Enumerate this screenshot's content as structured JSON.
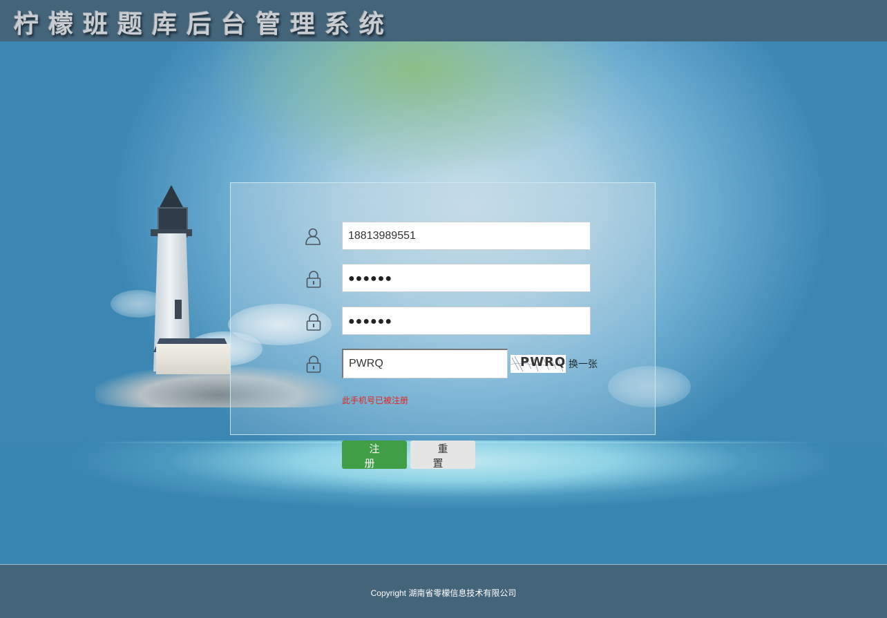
{
  "header": {
    "title": "柠檬班题库后台管理系统"
  },
  "form": {
    "phone_value": "18813989551",
    "password_value": "●●●●●●",
    "confirm_password_value": "●●●●●●",
    "captcha_value": "PWRQ",
    "captcha_image_text": "PWRQ",
    "refresh_captcha_label": "换一张",
    "error_message": "此手机号已被注册",
    "register_label": "注 册",
    "reset_label": "重 置"
  },
  "footer": {
    "copyright": "Copyright 湖南省零檬信息技术有限公司"
  },
  "icons": {
    "user": "user-icon",
    "lock": "lock-icon"
  },
  "colors": {
    "header_bg": "#44647a",
    "register_button": "#3f9e46",
    "reset_button": "#e5e5e5",
    "error_text": "#e8231c"
  }
}
